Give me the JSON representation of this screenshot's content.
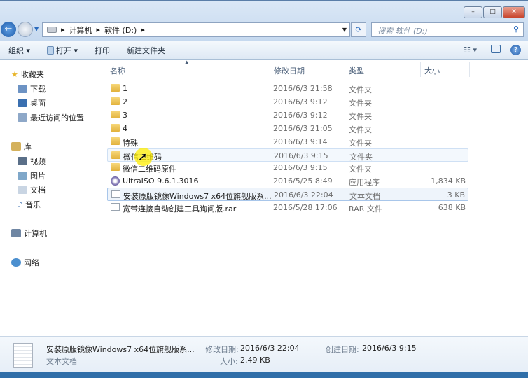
{
  "window": {
    "minimize": "–",
    "maximize": "□",
    "close": "✕"
  },
  "address": {
    "segments": [
      "计算机",
      "软件 (D:)"
    ],
    "search_placeholder": "搜索 软件 (D:)"
  },
  "toolbar": {
    "organize": "组织 ▾",
    "open": "打开 ▾",
    "print": "打印",
    "new_folder": "新建文件夹"
  },
  "sidebar": {
    "favorites": "收藏夹",
    "downloads": "下载",
    "desktop": "桌面",
    "recent": "最近访问的位置",
    "libraries": "库",
    "videos": "视频",
    "pictures": "图片",
    "documents": "文档",
    "music": "音乐",
    "computer": "计算机",
    "network": "网络"
  },
  "columns": {
    "name": "名称",
    "date": "修改日期",
    "type": "类型",
    "size": "大小"
  },
  "files": [
    {
      "name": "1",
      "date": "2016/6/3 21:58",
      "type": "文件夹",
      "size": "",
      "icon": "folder"
    },
    {
      "name": "2",
      "date": "2016/6/3 9:12",
      "type": "文件夹",
      "size": "",
      "icon": "folder"
    },
    {
      "name": "3",
      "date": "2016/6/3 9:12",
      "type": "文件夹",
      "size": "",
      "icon": "folder"
    },
    {
      "name": "4",
      "date": "2016/6/3 21:05",
      "type": "文件夹",
      "size": "",
      "icon": "folder"
    },
    {
      "name": "特殊",
      "date": "2016/6/3 9:14",
      "type": "文件夹",
      "size": "",
      "icon": "folder"
    },
    {
      "name": "微信二维码",
      "date": "2016/6/3 9:15",
      "type": "文件夹",
      "size": "",
      "icon": "folder"
    },
    {
      "name": "微信二维码原件",
      "date": "2016/6/3 9:15",
      "type": "文件夹",
      "size": "",
      "icon": "folder"
    },
    {
      "name": "UltraISO 9.6.1.3016",
      "date": "2016/5/25 8:49",
      "type": "应用程序",
      "size": "1,834 KB",
      "icon": "iso"
    },
    {
      "name": "安装原版镜像Windows7 x64位旗舰版系...",
      "date": "2016/6/3 22:04",
      "type": "文本文档",
      "size": "3 KB",
      "icon": "doc"
    },
    {
      "name": "宽带连接自动创建工具询问版.rar",
      "date": "2016/5/28 17:06",
      "type": "RAR 文件",
      "size": "638 KB",
      "icon": "doc"
    }
  ],
  "details": {
    "name": "安装原版镜像Windows7 x64位旗舰版系...",
    "type": "文本文档",
    "modified_label": "修改日期:",
    "modified": "2016/6/3 22:04",
    "size_label": "大小:",
    "size": "2.49 KB",
    "created_label": "创建日期:",
    "created": "2016/6/3 9:15"
  }
}
